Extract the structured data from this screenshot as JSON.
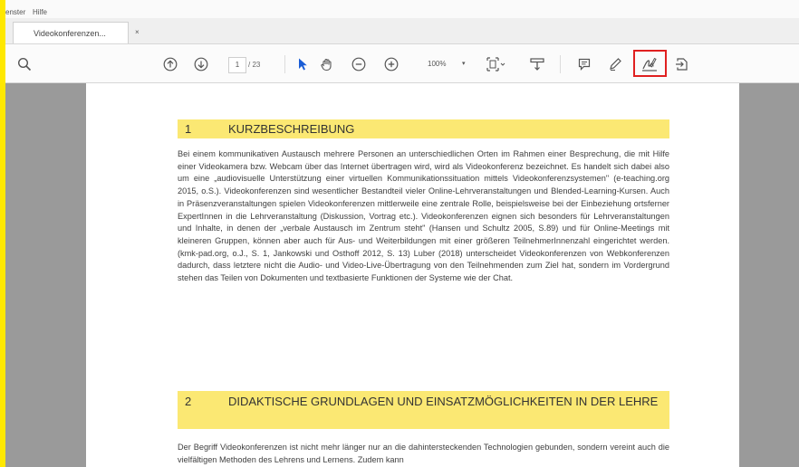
{
  "menubar": {
    "items": [
      "enster",
      "Hilfe"
    ]
  },
  "tab": {
    "title": "Videokonferenzen...",
    "close": "×"
  },
  "toolbar": {
    "page_current": "1",
    "page_total": "/ 23",
    "zoom": "100%"
  },
  "document": {
    "section1": {
      "number": "1",
      "title": "KURZBESCHREIBUNG",
      "paragraph": "Bei einem kommunikativen Austausch mehrere Personen an unterschiedlichen Orten im Rahmen einer Besprechung, die mit Hilfe einer Videokamera bzw. Webcam über das Internet übertragen wird, wird als Videokonferenz bezeichnet. Es handelt sich dabei also um eine „audiovisuelle Unterstützung einer virtuellen Kommunikationssituation mittels Videokonferenzsystemen\" (e-teaching.org 2015, o.S.). Videokonferenzen sind wesentlicher Bestandteil vieler Online-Lehrveranstaltungen und Blended-Learning-Kursen. Auch in Präsenzveranstaltungen spielen Videokonferenzen mittlerweile eine zentrale Rolle, beispielsweise bei der Einbeziehung ortsferner ExpertInnen in die Lehrveranstaltung (Diskussion, Vortrag etc.). Videokonferenzen eignen sich besonders für Lehrveranstaltungen und Inhalte, in denen der „verbale Austausch im Zentrum steht\" (Hansen und Schultz 2005, S.89) und für Online-Meetings mit kleineren Gruppen, können aber auch für Aus- und Weiterbildungen mit einer größeren TeilnehmerInnenzahl eingerichtet werden. (kmk-pad.org, o.J., S. 1, Jankowski und Osthoff 2012, S. 13) Luber (2018) unterscheidet Videokonferenzen von Webkonferenzen dadurch, dass letztere nicht die Audio- und Video-Live-Übertragung von den Teilnehmenden zum Ziel hat, sondern im Vordergrund stehen das Teilen von Dokumenten und textbasierte Funktionen der Systeme wie der Chat."
    },
    "section2": {
      "number": "2",
      "title": "DIDAKTISCHE GRUNDLAGEN UND EINSATZMÖGLICHKEITEN IN DER LEHRE",
      "paragraph": "Der Begriff Videokonferenzen ist nicht mehr länger nur an die dahintersteckenden Technologien gebunden, sondern vereint auch die vielfältigen Methoden des Lehrens und Lernens. Zudem kann"
    }
  },
  "colors": {
    "page_border": "#ffe800",
    "heading_bg": "#fbe873",
    "highlight_box": "#e02020",
    "select_tool": "#1a5dd6"
  }
}
